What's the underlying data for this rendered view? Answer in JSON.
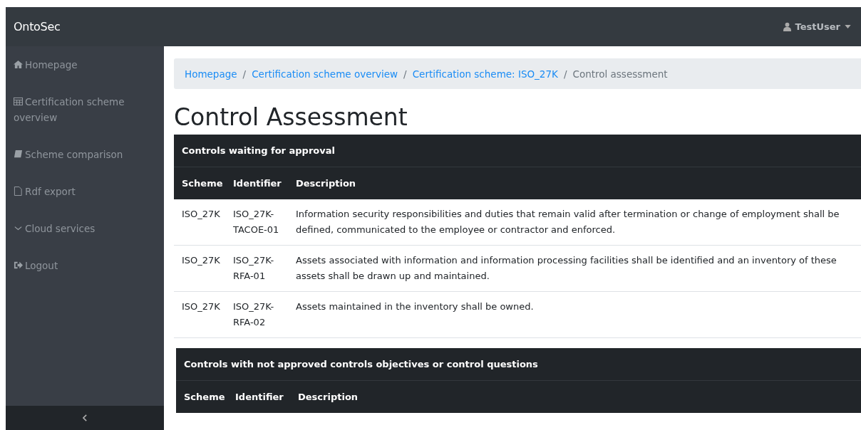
{
  "navbar": {
    "brand": "OntoSec",
    "user": "TestUser"
  },
  "sidebar": {
    "items": [
      {
        "label": "Homepage"
      },
      {
        "label": "Certification scheme overview"
      },
      {
        "label": "Scheme comparison"
      },
      {
        "label": "Rdf export"
      },
      {
        "label": "Cloud services"
      },
      {
        "label": "Logout"
      }
    ]
  },
  "breadcrumb": [
    {
      "label": "Homepage",
      "kind": "link"
    },
    {
      "separator": "/",
      "label": "Certification scheme overview",
      "kind": "link"
    },
    {
      "separator": "/",
      "label": "Certification scheme: ISO_27K",
      "kind": "link"
    },
    {
      "separator": "/",
      "label": "Control assessment",
      "kind": "current"
    }
  ],
  "heading": "Control Assessment",
  "tables": [
    {
      "title": "Controls waiting for approval",
      "columns": [
        "Scheme",
        "Identifier",
        "Description"
      ],
      "rows": [
        [
          "ISO_27K",
          "ISO_27K-TACOE-01",
          "Information security responsibilities and duties that remain valid after termination or change of employment shall be defined, communicated to the employee or contractor and enforced."
        ],
        [
          "ISO_27K",
          "ISO_27K-RFA-01",
          "Assets associated with information and information processing facilities shall be identified and an inventory of these assets shall be drawn up and maintained."
        ],
        [
          "ISO_27K",
          "ISO_27K-RFA-02",
          "Assets maintained in the inventory shall be owned."
        ]
      ]
    },
    {
      "title": "Controls with not approved controls objectives or control questions",
      "columns": [
        "Scheme",
        "Identifier",
        "Description"
      ]
    }
  ]
}
